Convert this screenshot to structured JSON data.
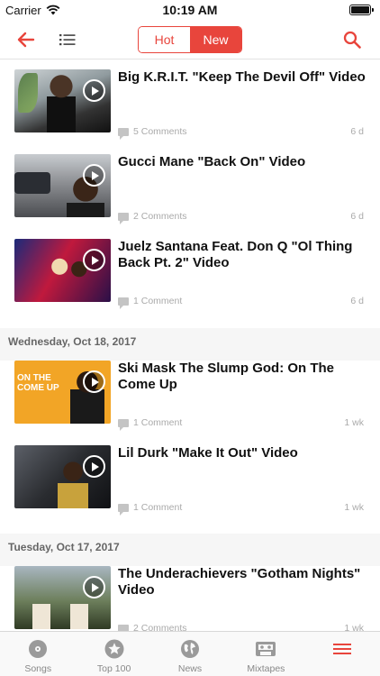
{
  "status_bar": {
    "carrier": "Carrier",
    "time": "10:19 AM",
    "battery_level": 1.0
  },
  "nav": {
    "segments": {
      "hot": "Hot",
      "new": "New",
      "selected": "New"
    },
    "accent_color": "#e8453c"
  },
  "feed": {
    "items": [
      {
        "title": "Big K.R.I.T. \"Keep The Devil Off\" Video",
        "comments": "5 Comments",
        "age": "6 d"
      },
      {
        "title": "Gucci Mane \"Back On\" Video",
        "comments": "2 Comments",
        "age": "6 d"
      },
      {
        "title": "Juelz Santana Feat. Don Q \"Ol Thing Back Pt. 2\" Video",
        "comments": "1 Comment",
        "age": "6 d"
      },
      {
        "title": "Ski Mask The Slump God: On The Come Up",
        "comments": "1 Comment",
        "age": "1 wk",
        "thumb_text": "ON THE COME UP"
      },
      {
        "title": "Lil Durk \"Make It Out\" Video",
        "comments": "1 Comment",
        "age": "1 wk"
      },
      {
        "title": "The Underachievers \"Gotham Nights\" Video",
        "comments": "2 Comments",
        "age": "1 wk"
      }
    ],
    "sections": [
      {
        "label": "Wednesday, Oct 18, 2017"
      },
      {
        "label": "Tuesday, Oct 17, 2017"
      }
    ]
  },
  "tab_bar": {
    "tabs": [
      {
        "label": "Songs",
        "icon": "disc-icon"
      },
      {
        "label": "Top 100",
        "icon": "star-icon"
      },
      {
        "label": "News",
        "icon": "globe-icon"
      },
      {
        "label": "Mixtapes",
        "icon": "cassette-icon"
      },
      {
        "label": "",
        "icon": "menu-icon"
      }
    ]
  }
}
